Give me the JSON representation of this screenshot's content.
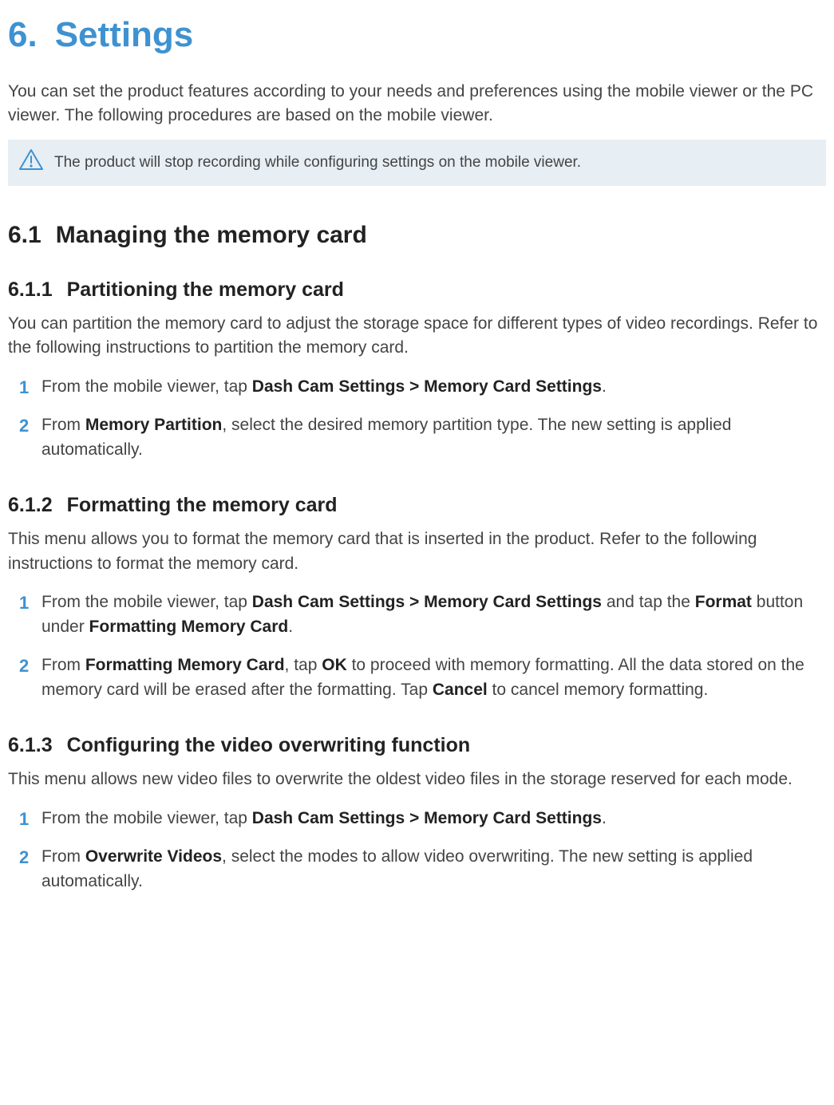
{
  "chapter": {
    "number": "6.",
    "title": "Settings"
  },
  "intro": "You can set the product features according to your needs and preferences using the mobile viewer or the PC viewer. The following procedures are based on the mobile viewer.",
  "callout": {
    "text": "The product will stop recording while configuring settings on the mobile viewer."
  },
  "s61": {
    "num": "6.1",
    "title": "Managing the memory card"
  },
  "s611": {
    "num": "6.1.1",
    "title": "Partitioning the memory card",
    "p": "You can partition the memory card to adjust the storage space for different types of video recordings. Refer to the following instructions to partition the memory card.",
    "step1_a": "From the mobile viewer, tap ",
    "step1_b": "Dash Cam Settings > Memory Card Settings",
    "step1_c": ".",
    "step2_a": "From ",
    "step2_b": "Memory Partition",
    "step2_c": ", select the desired memory partition type. The new setting is applied automatically."
  },
  "s612": {
    "num": "6.1.2",
    "title": "Formatting the memory card",
    "p": "This menu allows you to format the memory card that is inserted in the product. Refer to the following instructions to format the memory card.",
    "step1_a": "From the mobile viewer, tap ",
    "step1_b": "Dash Cam Settings > Memory Card Settings",
    "step1_c": " and tap the ",
    "step1_d": "Format",
    "step1_e": " button under ",
    "step1_f": "Formatting Memory Card",
    "step1_g": ".",
    "step2_a": "From ",
    "step2_b": "Formatting Memory Card",
    "step2_c": ", tap ",
    "step2_d": "OK",
    "step2_e": " to proceed with memory formatting. All the data stored on the memory card will be erased after the formatting. Tap ",
    "step2_f": "Cancel",
    "step2_g": " to cancel memory formatting."
  },
  "s613": {
    "num": "6.1.3",
    "title": "Configuring the video overwriting function",
    "p": "This menu allows new video files to overwrite the oldest video files in the storage reserved for each mode.",
    "step1_a": "From the mobile viewer, tap ",
    "step1_b": "Dash Cam Settings > Memory Card Settings",
    "step1_c": ".",
    "step2_a": "From ",
    "step2_b": "Overwrite Videos",
    "step2_c": ", select the modes to allow video overwriting. The new setting is applied automatically."
  },
  "nums": {
    "one": "1",
    "two": "2"
  }
}
